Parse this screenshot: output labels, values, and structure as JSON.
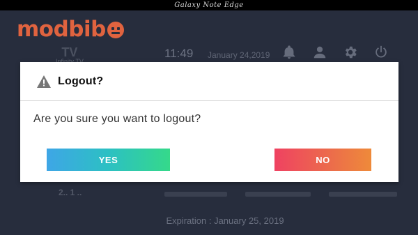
{
  "device": {
    "label": "Galaxy Note Edge"
  },
  "watermark": {
    "text": "modbib"
  },
  "app": {
    "logo_big": "TV",
    "logo_small": "Infinity TV",
    "time": "11:49",
    "date": "January 24,2019",
    "icons": [
      "bell-icon",
      "user-icon",
      "gear-icon",
      "power-icon"
    ],
    "expiration": "Expiration : January 25, 2019",
    "bg_number": "2.. 1 .."
  },
  "dialog": {
    "icon": "warning-icon",
    "title": "Logout?",
    "message": "Are you sure you want to logout?",
    "yes_label": "YES",
    "no_label": "NO"
  },
  "colors": {
    "background": "#272d3d",
    "yes_gradient": [
      "#3ea6e6",
      "#35d98a"
    ],
    "no_gradient": [
      "#ef4261",
      "#ee8a3a"
    ],
    "watermark": "#e0633f"
  }
}
